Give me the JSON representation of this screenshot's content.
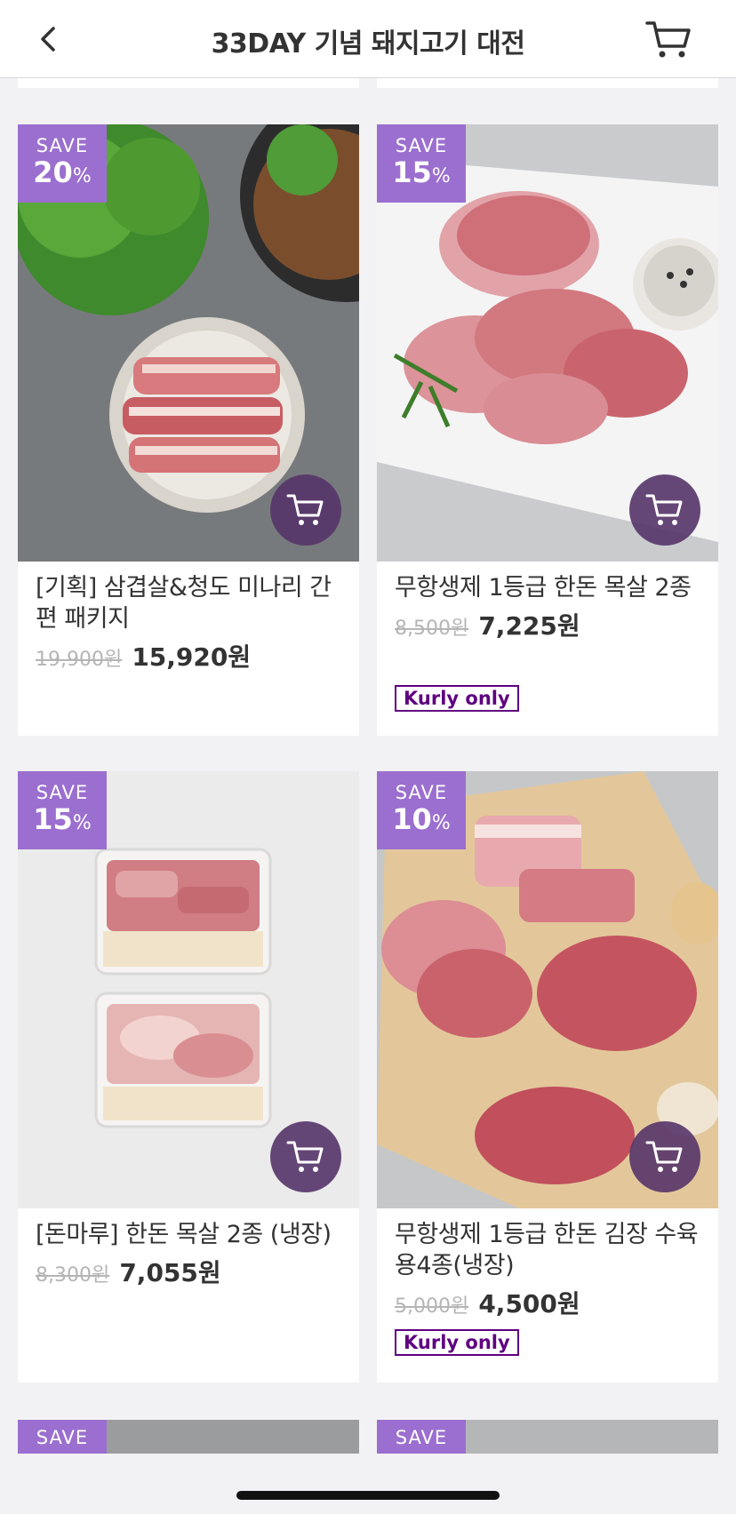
{
  "header": {
    "title": "33DAY 기념 돼지고기 대전"
  },
  "badge_save_label": "SAVE",
  "products": [
    {
      "discount": "20",
      "pct_sign": "%",
      "name": "[기획] 삼겹살&청도 미나리 간편 패키지",
      "original_price": "19,900원",
      "price": "15,920원",
      "tag": ""
    },
    {
      "discount": "15",
      "pct_sign": "%",
      "name": "무항생제 1등급 한돈 목살 2종",
      "original_price": "8,500원",
      "price": "7,225원",
      "tag": "Kurly only"
    },
    {
      "discount": "15",
      "pct_sign": "%",
      "name": "[돈마루] 한돈 목살 2종 (냉장)",
      "original_price": "8,300원",
      "price": "7,055원",
      "tag": ""
    },
    {
      "discount": "10",
      "pct_sign": "%",
      "name": "무항생제 1등급 한돈 김장 수육용4종(냉장)",
      "original_price": "5,000원",
      "price": "4,500원",
      "tag": "Kurly only"
    }
  ],
  "colors": {
    "badge": "#9b6fcf",
    "kurly_only": "#5f0080",
    "cart_circle": "#553469"
  },
  "icons": {
    "back": "chevron-left-icon",
    "cart": "cart-icon"
  }
}
